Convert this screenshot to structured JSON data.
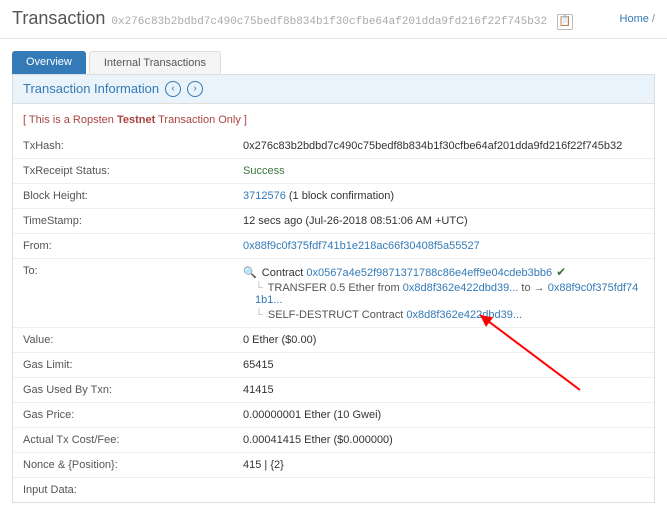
{
  "header": {
    "title": "Transaction",
    "hash": "0x276c83b2bdbd7c490c75bedf8b834b1f30cfbe64af201dda9fd216f22f745b32",
    "copy_icon": "📋"
  },
  "breadcrumb": {
    "home": "Home",
    "sep": " / "
  },
  "tabs": {
    "overview": "Overview",
    "internal": "Internal Transactions"
  },
  "panel": {
    "title": "Transaction Information",
    "prev": "‹",
    "next": "›"
  },
  "ropsten": {
    "open": "[ This is a Ropsten ",
    "bold": "Testnet",
    "close": " Transaction Only ]"
  },
  "fields": {
    "txhash_label": "TxHash:",
    "txhash_value": "0x276c83b2bdbd7c490c75bedf8b834b1f30cfbe64af201dda9fd216f22f745b32",
    "receipt_label": "TxReceipt Status:",
    "receipt_value": "Success",
    "block_label": "Block Height:",
    "block_link": "3712576",
    "block_conf": " (1 block confirmation)",
    "time_label": "TimeStamp:",
    "time_value": "12 secs ago (Jul-26-2018 08:51:06 AM +UTC)",
    "from_label": "From:",
    "from_value": "0x88f9c0f375fdf741b1e218ac66f30408f5a55527",
    "to_label": "To:",
    "to_icon": "🔍",
    "to_contract_word": " Contract ",
    "to_contract_addr": "0x0567a4e52f9871371788c86e4eff9e04cdeb3bb6",
    "to_check": "✔",
    "transfer_tree": "└",
    "transfer_text": " TRANSFER  0.5 Ether from ",
    "transfer_from": "0x8d8f362e422dbd39...",
    "transfer_to_word": " to → ",
    "transfer_to": "0x88f9c0f375fdf741b1...",
    "selfd_tree": "└",
    "selfd_text": " SELF-DESTRUCT Contract ",
    "selfd_addr": "0x8d8f362e422dbd39...",
    "value_label": "Value:",
    "value_value": "0 Ether ($0.00)",
    "gaslimit_label": "Gas Limit:",
    "gaslimit_value": "65415",
    "gasused_label": "Gas Used By Txn:",
    "gasused_value": "41415",
    "gasprice_label": "Gas Price:",
    "gasprice_value": "0.00000001 Ether (10 Gwei)",
    "cost_label": "Actual Tx Cost/Fee:",
    "cost_value": "0.00041415 Ether ($0.000000)",
    "nonce_label": "Nonce & {Position}:",
    "nonce_value": "415 | {2}",
    "input_label": "Input Data:"
  }
}
